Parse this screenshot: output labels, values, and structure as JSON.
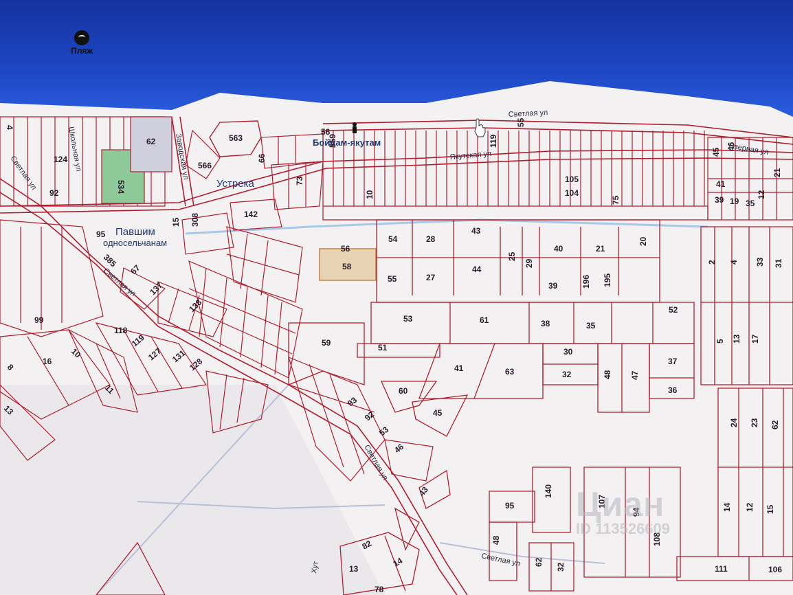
{
  "poi": {
    "label": "Пляж",
    "icon": "beach-icon"
  },
  "places": [
    {
      "id": "ustreka",
      "label": "Устрека"
    },
    {
      "id": "pavshim",
      "label": "Павшим"
    },
    {
      "id": "odnoselchanam",
      "label": "односельчанам"
    },
    {
      "id": "boytsam",
      "label": "Бойцам-якутам"
    }
  ],
  "streets": [
    {
      "id": "svetlaya-top",
      "label": "Светлая ул"
    },
    {
      "id": "ozernaya",
      "label": "Озерная ул"
    },
    {
      "id": "yakutskaya",
      "label": "Якутская ул"
    },
    {
      "id": "zavodskaya",
      "label": "Заводская ул"
    },
    {
      "id": "svetlaya-west",
      "label": "Светлая ул"
    },
    {
      "id": "svetlaya-mid",
      "label": "Светлая ул"
    },
    {
      "id": "svetlaya-south",
      "label": "Светлая ул"
    },
    {
      "id": "school",
      "label": "Школьная ул"
    },
    {
      "id": "khut",
      "label": "Хут"
    }
  ],
  "parcels": [
    "4",
    "92",
    "124",
    "62",
    "534",
    "563",
    "566",
    "56",
    "559",
    "119",
    "55",
    "45",
    "46",
    "66",
    "73",
    "10",
    "105",
    "104",
    "75",
    "41",
    "39",
    "19",
    "35",
    "12",
    "21",
    "142",
    "308",
    "15",
    "95",
    "385",
    "67",
    "137",
    "138",
    "99",
    "16",
    "8",
    "13",
    "10",
    "11",
    "118",
    "119",
    "127",
    "131",
    "128",
    "56",
    "58",
    "54",
    "28",
    "43",
    "40",
    "21",
    "20",
    "55",
    "27",
    "44",
    "25",
    "29",
    "39",
    "196",
    "195",
    "2",
    "4",
    "33",
    "31",
    "53",
    "61",
    "38",
    "35",
    "52",
    "59",
    "51",
    "41",
    "63",
    "30",
    "32",
    "48",
    "47",
    "37",
    "36",
    "5",
    "13",
    "17",
    "60",
    "45",
    "93",
    "92",
    "53",
    "46",
    "43",
    "95",
    "140",
    "107",
    "94",
    "108",
    "48",
    "62",
    "32",
    "82",
    "13",
    "14",
    "78",
    "24",
    "23",
    "62",
    "14",
    "12",
    "15",
    "111",
    "106"
  ],
  "watermark": {
    "brand": "Циан",
    "id": "ID 113526609"
  },
  "colors": {
    "water": "#2a5ee0",
    "land": "#f4f1f1",
    "parcel_line": "#b01e2e",
    "highlight_parcel": "#e8d4b4",
    "green_parcel": "#8ec99a"
  }
}
